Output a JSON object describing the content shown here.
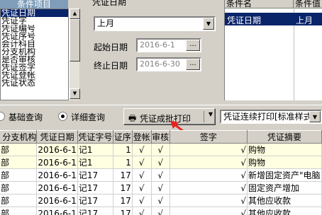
{
  "field_list": {
    "header": "条件项目",
    "items": [
      "凭证日期",
      "凭证字",
      "凭证编号",
      "凭证序号",
      "会计科目",
      "分支机构",
      "是否审核",
      "凭证签字",
      "凭证登帐",
      "凭证状态"
    ],
    "selected_index": 0
  },
  "conditions": {
    "field_label": "凭证日期",
    "period_value": "上月",
    "start_label": "起始日期",
    "start_value": "2016-6-1",
    "end_label": "终止日期",
    "end_value": "2016-6-30",
    "dots": "..."
  },
  "selected_conditions": {
    "col_name": "条件名",
    "col_value": "条件值",
    "rows": [
      {
        "name": "凭证日期",
        "value": "上月"
      }
    ]
  },
  "query_mode": {
    "basic_label": "基础查询",
    "detail_label": "详细查询",
    "selected": "detail",
    "print_button": "凭证成批打印",
    "print_mode": "凭证连续打印[标准样式]"
  },
  "grid": {
    "columns": [
      "分支机构",
      "凭证日期",
      "凭证字号",
      "证序",
      "登帐",
      "审核",
      "签字",
      "凭证摘要"
    ],
    "rows": [
      {
        "branch": "部",
        "date": "2016-6-1",
        "voucher": "记1",
        "seq": "1",
        "post": "√",
        "audit": "√",
        "sign": "√",
        "summary": "购物",
        "hl": true
      },
      {
        "branch": "部",
        "date": "2016-6-1",
        "voucher": "记1",
        "seq": "1",
        "post": "√",
        "audit": "√",
        "sign": "√",
        "summary": "购物",
        "hl": true
      },
      {
        "branch": "部",
        "date": "2016-6-1",
        "voucher": "记17",
        "seq": "17",
        "post": "√",
        "audit": "√",
        "sign": "√",
        "summary": "新增固定资产\"电脑",
        "hl": false
      },
      {
        "branch": "部",
        "date": "2016-6-1",
        "voucher": "记17",
        "seq": "17",
        "post": "√",
        "audit": "√",
        "sign": "√",
        "summary": "固定资产增加",
        "hl": false
      },
      {
        "branch": "部",
        "date": "2016-6-1",
        "voucher": "记17",
        "seq": "17",
        "post": "√",
        "audit": "√",
        "sign": "√",
        "summary": "其他应收款",
        "hl": false
      },
      {
        "branch": "部",
        "date": "2016-6-1",
        "voucher": "记17",
        "seq": "17",
        "post": "√",
        "audit": "√",
        "sign": "√",
        "summary": "其他应收款",
        "hl": false
      }
    ]
  }
}
